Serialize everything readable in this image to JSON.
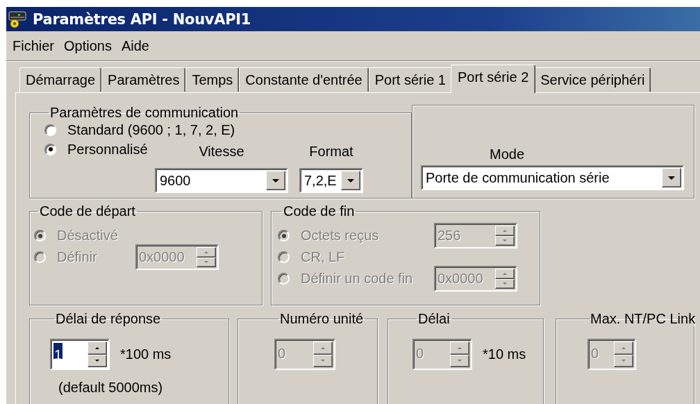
{
  "window": {
    "title": "Paramètres API - NouvAPI1"
  },
  "menu": [
    {
      "label": "Fichier"
    },
    {
      "label": "Options"
    },
    {
      "label": "Aide"
    }
  ],
  "tabs": [
    {
      "label": "Démarrage",
      "selected": false
    },
    {
      "label": "Paramètres",
      "selected": false
    },
    {
      "label": "Temps",
      "selected": false
    },
    {
      "label": "Constante d'entrée",
      "selected": false
    },
    {
      "label": "Port série 1",
      "selected": false
    },
    {
      "label": "Port série 2",
      "selected": true
    },
    {
      "label": "Service périphéri",
      "selected": false
    }
  ],
  "communication": {
    "title": "Paramètres de communication",
    "options": [
      {
        "label": "Standard (9600 ; 1, 7, 2, E)",
        "selected": false
      },
      {
        "label": "Personnalisé",
        "selected": true
      }
    ],
    "speed": {
      "label": "Vitesse",
      "value": "9600"
    },
    "format": {
      "label": "Format",
      "value": "7,2,E"
    }
  },
  "mode": {
    "label": "Mode",
    "value": "Porte de communication série"
  },
  "code_groups": [
    {
      "title": "Code de départ",
      "disabled": true,
      "options": [
        {
          "label": "Désactivé",
          "selected": true
        },
        {
          "label": "Définir",
          "selected": false,
          "value": "0x0000"
        }
      ]
    },
    {
      "title": "Code de fin",
      "disabled": true,
      "options": [
        {
          "label": "Octets reçus",
          "selected": true,
          "value": "256"
        },
        {
          "label": "CR, LF",
          "selected": false
        },
        {
          "label": "Définir un code fin",
          "selected": false,
          "value": "0x0000"
        }
      ]
    }
  ],
  "timing_groups": [
    {
      "title": "Délai de réponse",
      "disabled": false,
      "value": "1",
      "value_selected": true,
      "unit": "*100 ms",
      "note": "(default 5000ms)"
    },
    {
      "title": "Numéro unité",
      "disabled": true,
      "value": "0"
    },
    {
      "title": "Délai",
      "disabled": true,
      "value": "0",
      "unit": "*10 ms"
    },
    {
      "title": "Max. NT/PC Link",
      "disabled": true,
      "value": "0"
    }
  ]
}
